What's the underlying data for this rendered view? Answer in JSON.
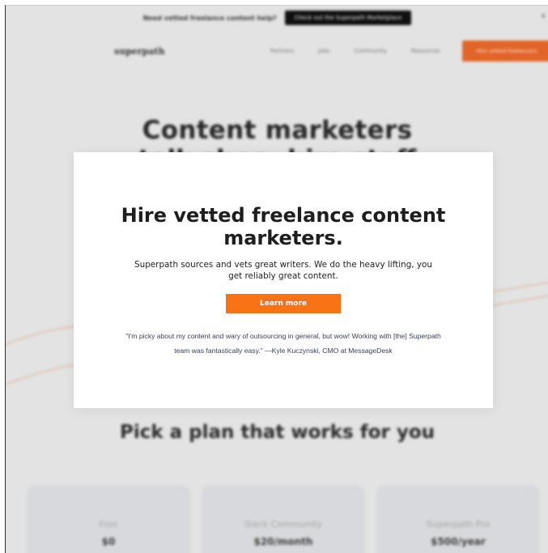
{
  "announcement": {
    "text": "Need vetted freelance content help?",
    "cta": "Check out the Superpath Marketplace",
    "close": "x"
  },
  "nav": {
    "logo": "superpath",
    "links": [
      "Partners",
      "Jobs",
      "Community",
      "Resources"
    ],
    "cta": "Hire vetted freelancers"
  },
  "hero": {
    "title_line1": "Content marketers",
    "title_line2": "talk shop, hire staff"
  },
  "plans": {
    "heading": "Pick a plan that works for you",
    "items": [
      {
        "name": "Free",
        "price": "$0"
      },
      {
        "name": "Slack Community",
        "price": "$20/month"
      },
      {
        "name": "Superpath Pro",
        "price": "$500/year"
      }
    ]
  },
  "modal": {
    "title": "Hire vetted freelance content marketers.",
    "subtitle": "Superpath sources and vets great writers. We do the heavy lifting, you get reliably great content.",
    "button": "Learn more",
    "quote": "\"I'm picky about my content and wary of outsourcing in general, but wow! Working with [the] Superpath team was fantastically easy.\" —Kyle Kuczynski, CMO at MessageDesk"
  },
  "colors": {
    "accent": "#f97316",
    "page_bg": "#f2f2f2"
  }
}
